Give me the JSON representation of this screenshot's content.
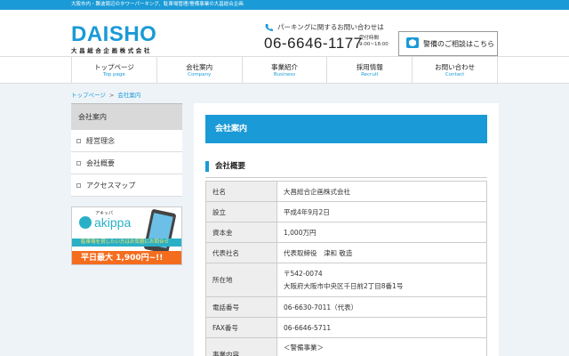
{
  "topbar": {
    "text": "大阪市内・難波周辺のタワーパーキング、駐車場管理/警備事業の大昌総合企画"
  },
  "header": {
    "logo_main": "DAISHO",
    "logo_sub": "大昌総合企画株式会社",
    "phone_caption": "パーキングに関するお問い合わせは",
    "phone_number": "06-6646-1177",
    "hours_label": "受付時間",
    "hours_value": "9:00~18:00",
    "consult_label": "警備のご相談はこちら"
  },
  "nav": {
    "items": [
      {
        "jp": "トップページ",
        "en": "Top page"
      },
      {
        "jp": "会社案内",
        "en": "Company"
      },
      {
        "jp": "事業紹介",
        "en": "Business"
      },
      {
        "jp": "採用情報",
        "en": "Recruit"
      },
      {
        "jp": "お問い合わせ",
        "en": "Contact"
      }
    ]
  },
  "breadcrumb": {
    "home": "トップページ",
    "separator": ">",
    "current": "会社案内"
  },
  "sidebar": {
    "heading": "会社案内",
    "items": [
      "経営理念",
      "会社概要",
      "アクセスマップ"
    ]
  },
  "banner": {
    "tag": "アキッパ",
    "name": "akippa",
    "line1": "駐車場を貸したい方はお気軽にお問合せ",
    "line2": "平日最大 1,900円~!!"
  },
  "main": {
    "title": "会社案内",
    "section_heading": "会社概要",
    "rows": [
      {
        "label": "社名",
        "value": "大昌総合企画株式会社"
      },
      {
        "label": "設立",
        "value": "平成4年9月2日"
      },
      {
        "label": "資本金",
        "value": "1,000万円"
      },
      {
        "label": "代表社名",
        "value": "代表取締役　津和 敬造"
      },
      {
        "label": "所在地",
        "value1": "〒542-0074",
        "value2": "大阪府大阪市中央区千日前2丁目8番1号"
      },
      {
        "label": "電話番号",
        "value": "06-6630-7011（代表）"
      },
      {
        "label": "FAX番号",
        "value": "06-6646-5711"
      },
      {
        "label": "事業内容",
        "value1": "＜警備事業＞",
        "value2": ""
      }
    ]
  },
  "colors": {
    "accent": "#1a9ad6",
    "banner_teal": "#2ab0c6",
    "banner_orange": "#f46d1f"
  }
}
